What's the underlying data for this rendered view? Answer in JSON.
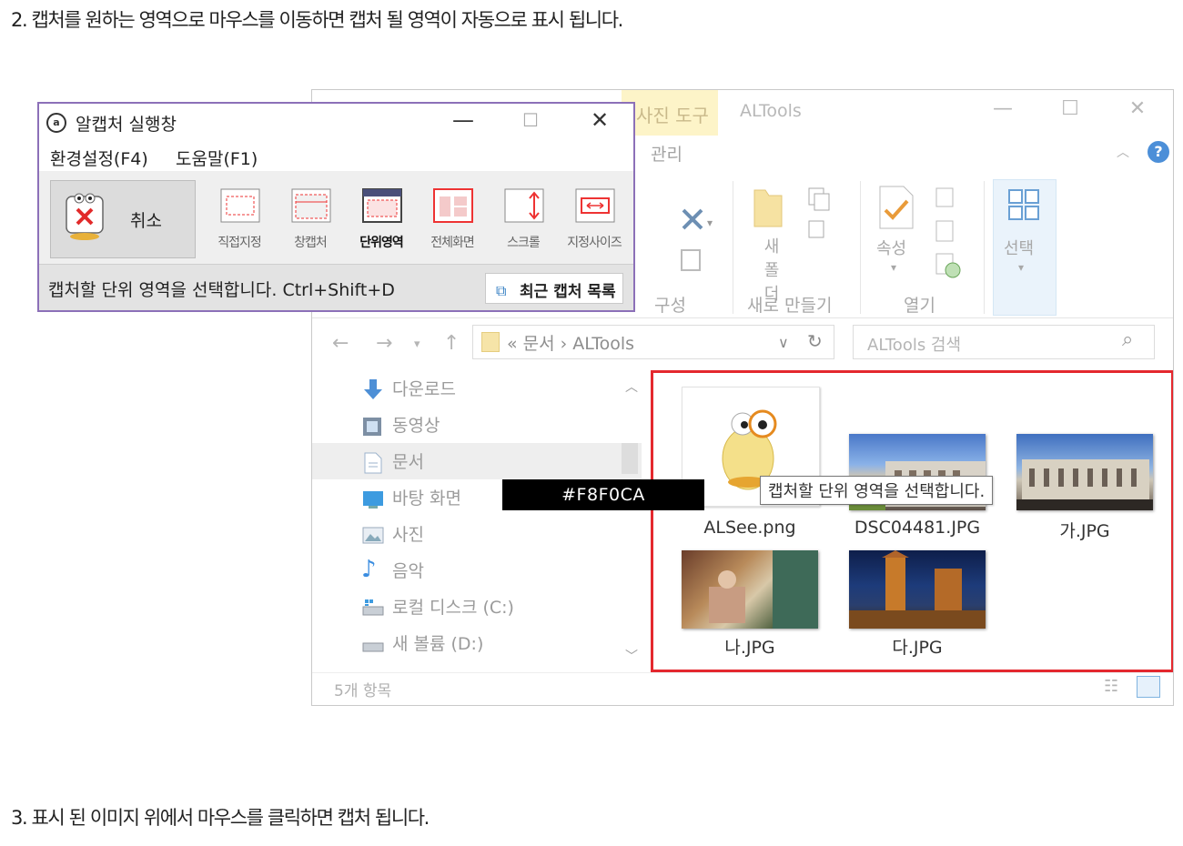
{
  "doc": {
    "step2": "2. 캡처를 원하는 영역으로 마우스를 이동하면 캡처 될 영역이 자동으로 표시 됩니다.",
    "step3": "3. 표시 된 이미지 위에서 마우스를 클릭하면 캡처 됩니다."
  },
  "explorer": {
    "context_tab": "사진 도구",
    "title": "ALTools",
    "manage_tab": "관리",
    "ribbon": {
      "new_folder": "새\n폴더",
      "properties": "속성",
      "select": "선택",
      "group_organize": "구성",
      "group_new": "새로 만들기",
      "group_open": "열기"
    },
    "address": {
      "crumb": "«  문서  ›  ALTools"
    },
    "search": {
      "placeholder": "ALTools 검색"
    },
    "nav": [
      "다운로드",
      "동영상",
      "문서",
      "바탕 화면",
      "사진",
      "음악",
      "로컬 디스크 (C:)",
      "새 볼륨 (D:)"
    ],
    "files": [
      "ALSee.png",
      "DSC04481.JPG",
      "가.JPG",
      "나.JPG",
      "다.JPG"
    ],
    "status": "5개 항목",
    "tooltip": "캡처할 단위 영역을 선택합니다."
  },
  "color_label": "#F8F0CA",
  "alcapture": {
    "title": "알캡처 실행창",
    "menu": [
      "환경설정(F4)",
      "도움말(F1)"
    ],
    "cancel": "취소",
    "modes": [
      "직접지정",
      "창캡처",
      "단위영역",
      "전체화면",
      "스크롤",
      "지정사이즈"
    ],
    "active_mode": "단위영역",
    "status": "캡처할 단위 영역을 선택합니다. Ctrl+Shift+D",
    "recent_button": "최근 캡처 목록"
  },
  "colors": {
    "capture_frame": "#e4282e",
    "alcapture_border": "#8c70b8",
    "context_tab": "#fdf4c8",
    "accent_blue": "#2f7cc1"
  }
}
